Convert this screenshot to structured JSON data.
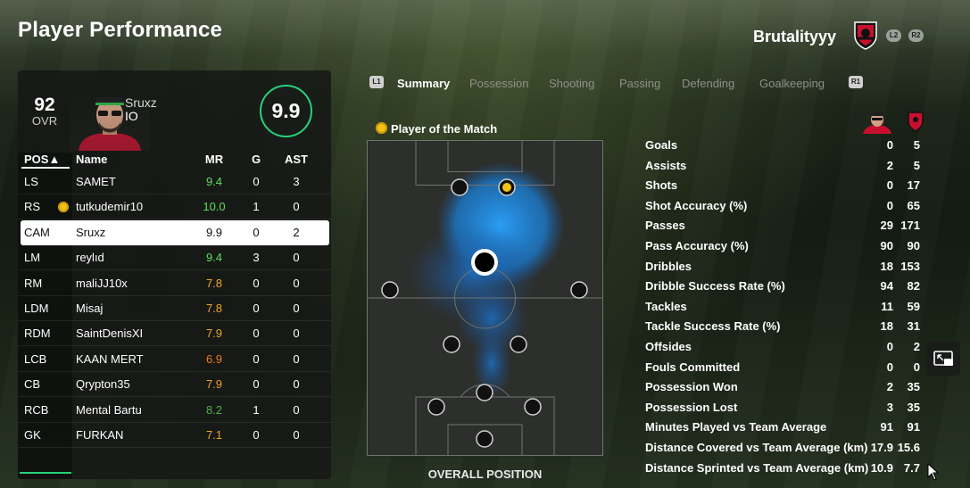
{
  "header": {
    "title": "Player Performance",
    "team_name": "Brutalityyy",
    "buttons": [
      "L2",
      "R2"
    ]
  },
  "player_card": {
    "ovr_value": "92",
    "ovr_label": "OVR",
    "name": "Sruxz",
    "position": "IO",
    "match_rating": "9.9"
  },
  "table": {
    "headers": {
      "pos": "POS▲",
      "name": "Name",
      "mr": "MR",
      "g": "G",
      "ast": "AST"
    },
    "rows": [
      {
        "pos": "LS",
        "name": "SAMET",
        "mr": "9.4",
        "mr_color": "#5ae05a",
        "g": "0",
        "ast": "3",
        "star": false,
        "selected": false
      },
      {
        "pos": "RS",
        "name": "tutkudemir10",
        "mr": "10.0",
        "mr_color": "#5ae05a",
        "g": "1",
        "ast": "0",
        "star": true,
        "selected": false
      },
      {
        "pos": "CAM",
        "name": "Sruxz",
        "mr": "9.9",
        "mr_color": "#111111",
        "g": "0",
        "ast": "2",
        "star": false,
        "selected": true
      },
      {
        "pos": "LM",
        "name": "reylıd",
        "mr": "9.4",
        "mr_color": "#5ae05a",
        "g": "3",
        "ast": "0",
        "star": false,
        "selected": false
      },
      {
        "pos": "RM",
        "name": "maliJJ10x",
        "mr": "7.8",
        "mr_color": "#f0a426",
        "g": "0",
        "ast": "0",
        "star": false,
        "selected": false
      },
      {
        "pos": "LDM",
        "name": "Misaj",
        "mr": "7.8",
        "mr_color": "#f0a426",
        "g": "0",
        "ast": "0",
        "star": false,
        "selected": false
      },
      {
        "pos": "RDM",
        "name": "SaintDenisXI",
        "mr": "7.9",
        "mr_color": "#f0a426",
        "g": "0",
        "ast": "0",
        "star": false,
        "selected": false
      },
      {
        "pos": "LCB",
        "name": "KAAN MERT",
        "mr": "6.9",
        "mr_color": "#f07a26",
        "g": "0",
        "ast": "0",
        "star": false,
        "selected": false
      },
      {
        "pos": "CB",
        "name": "Qrypton35",
        "mr": "7.9",
        "mr_color": "#f0a426",
        "g": "0",
        "ast": "0",
        "star": false,
        "selected": false
      },
      {
        "pos": "RCB",
        "name": "Mental Bartu",
        "mr": "8.2",
        "mr_color": "#4caf50",
        "g": "1",
        "ast": "0",
        "star": false,
        "selected": false
      },
      {
        "pos": "GK",
        "name": "FURKAN",
        "mr": "7.1",
        "mr_color": "#f0a426",
        "g": "0",
        "ast": "0",
        "star": false,
        "selected": false
      }
    ]
  },
  "tabs": {
    "left_key": "L1",
    "right_key": "R1",
    "items": [
      "Summary",
      "Possession",
      "Shooting",
      "Passing",
      "Defending",
      "Goalkeeping"
    ],
    "active": "Summary"
  },
  "potm_label": "Player of the Match",
  "pitch_title": "OVERALL POSITION",
  "stats": [
    {
      "label": "Goals",
      "player": "0",
      "team": "5"
    },
    {
      "label": "Assists",
      "player": "2",
      "team": "5"
    },
    {
      "label": "Shots",
      "player": "0",
      "team": "17"
    },
    {
      "label": "Shot Accuracy (%)",
      "player": "0",
      "team": "65"
    },
    {
      "label": "Passes",
      "player": "29",
      "team": "171"
    },
    {
      "label": "Pass Accuracy (%)",
      "player": "90",
      "team": "90"
    },
    {
      "label": "Dribbles",
      "player": "18",
      "team": "153"
    },
    {
      "label": "Dribble Success Rate (%)",
      "player": "94",
      "team": "82"
    },
    {
      "label": "Tackles",
      "player": "11",
      "team": "59"
    },
    {
      "label": "Tackle Success Rate (%)",
      "player": "18",
      "team": "31"
    },
    {
      "label": "Offsides",
      "player": "0",
      "team": "2"
    },
    {
      "label": "Fouls Committed",
      "player": "0",
      "team": "0"
    },
    {
      "label": "Possession Won",
      "player": "2",
      "team": "35"
    },
    {
      "label": "Possession Lost",
      "player": "3",
      "team": "35"
    },
    {
      "label": "Minutes Played vs Team Average",
      "player": "91",
      "team": "91"
    },
    {
      "label": "Distance Covered vs Team Average (km)",
      "player": "17.9",
      "team": "15.6"
    },
    {
      "label": "Distance Sprinted vs Team Average (km)",
      "player": "10.9",
      "team": "7.7"
    }
  ],
  "colors": {
    "accent_green": "#27d07a",
    "heatmap_blue": "#1c8ee6",
    "potm_gold": "#f2c21b"
  }
}
